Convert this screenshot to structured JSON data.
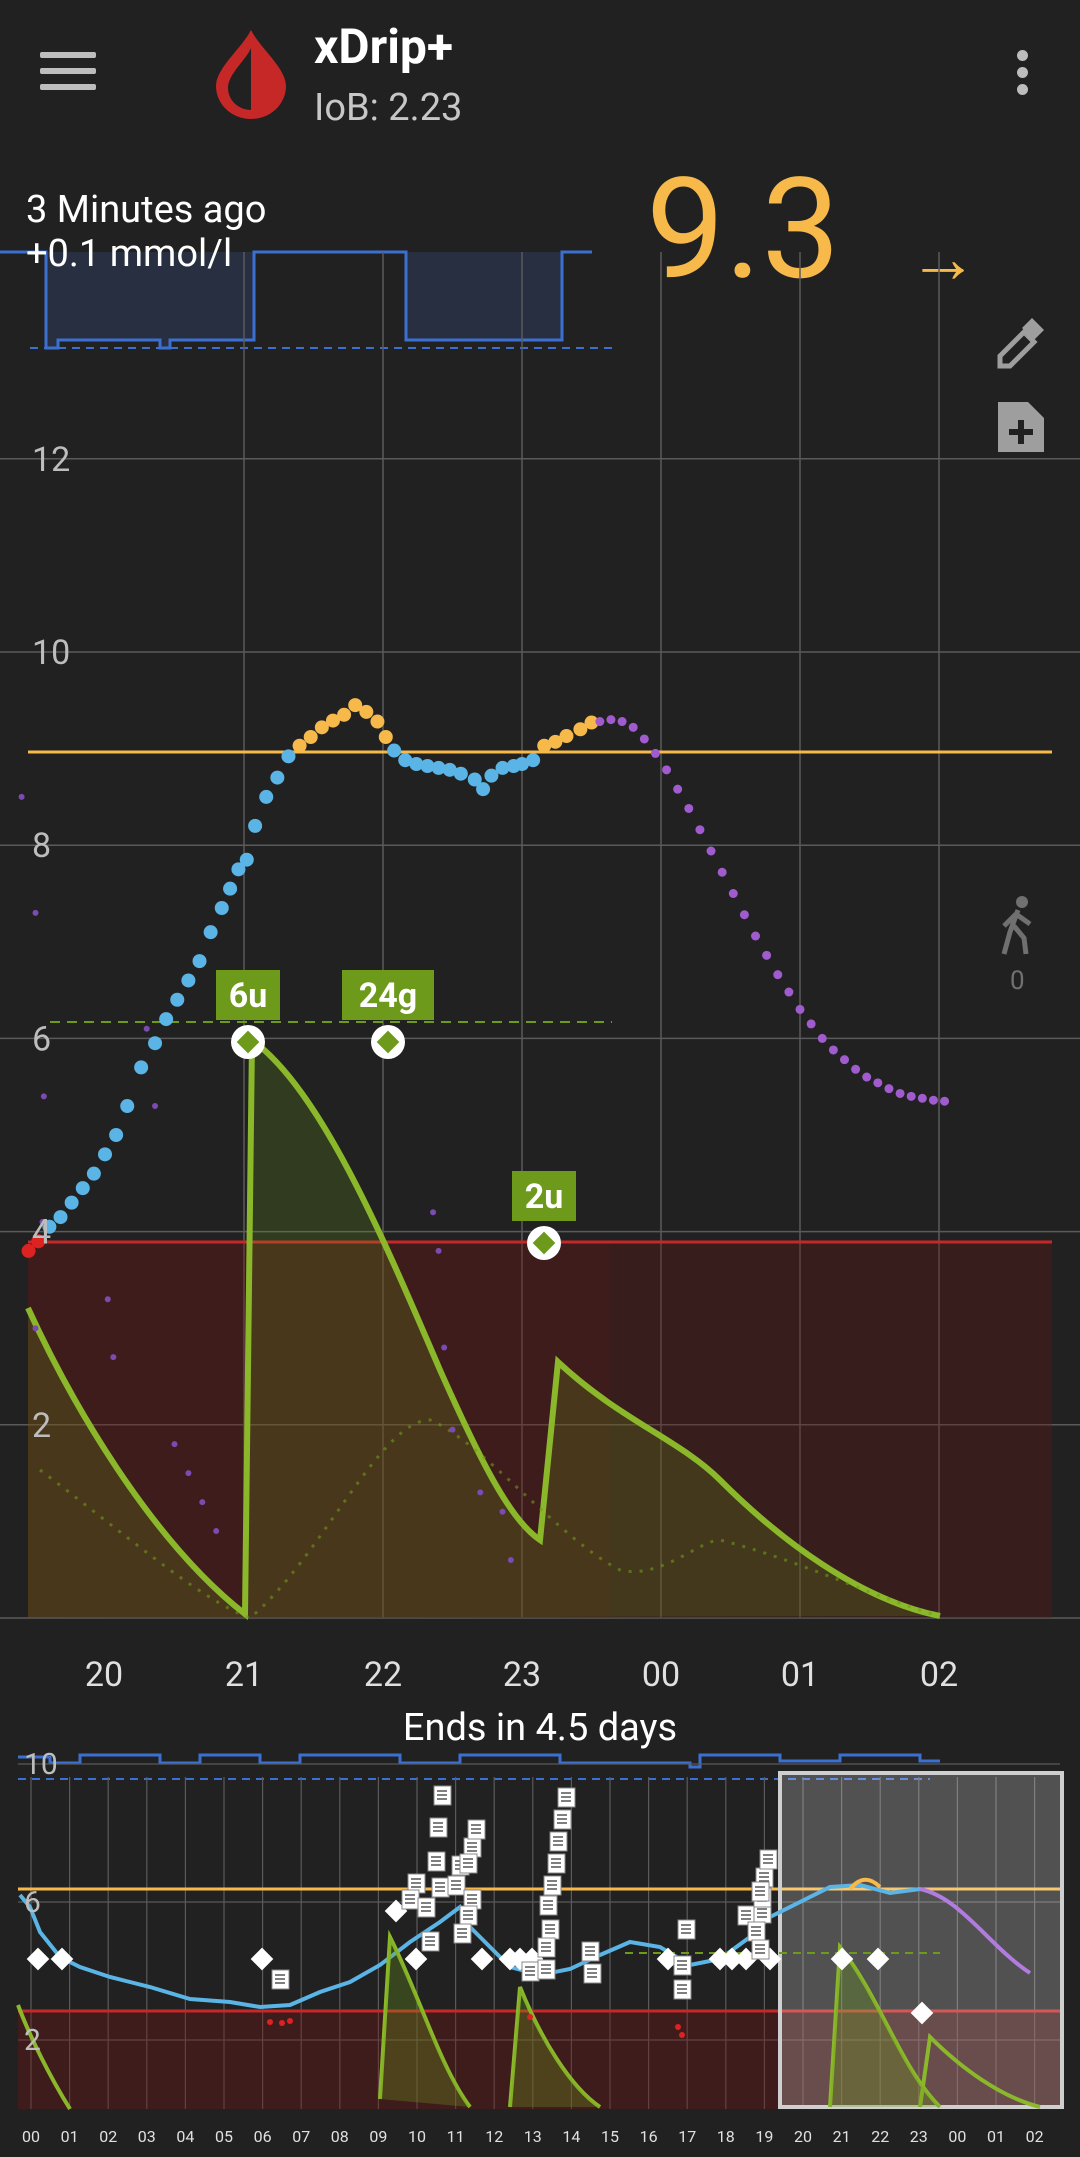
{
  "app": {
    "title": "xDrip+",
    "iob": "IoB: 2.23"
  },
  "status": {
    "ago": "3 Minutes ago",
    "delta": "+0.1 mmol/l",
    "bg": "9.3",
    "trend": "→"
  },
  "steps": {
    "count": "0"
  },
  "main_chart": {
    "y_ticks": [
      "12",
      "10",
      "8",
      "6",
      "4",
      "2"
    ],
    "x_ticks": [
      "20",
      "21",
      "22",
      "23",
      "00",
      "01",
      "02"
    ],
    "treatments": [
      "6u",
      "24g",
      "2u"
    ]
  },
  "overview": {
    "title": "Ends in 4.5 days",
    "y_ticks": [
      "10",
      "6",
      "2"
    ],
    "x_ticks": [
      "00",
      "01",
      "02",
      "03",
      "04",
      "05",
      "06",
      "07",
      "08",
      "09",
      "10",
      "11",
      "12",
      "13",
      "14",
      "15",
      "16",
      "17",
      "18",
      "19",
      "20",
      "21",
      "22",
      "23",
      "00",
      "01",
      "02"
    ]
  },
  "colors": {
    "high_line": "#f6b94a",
    "low_line": "#d22",
    "in_range": "#5ab4e5",
    "predicted": "#a05ccf",
    "treatment": "#6e9a1c",
    "basal": "#3b6fd0"
  },
  "icons": {
    "menu": "menu-icon",
    "logo": "blood-drop-icon",
    "overflow": "more-vert-icon",
    "calibrate": "eyedropper-icon",
    "note": "add-note-icon",
    "steps": "walking-icon"
  }
}
